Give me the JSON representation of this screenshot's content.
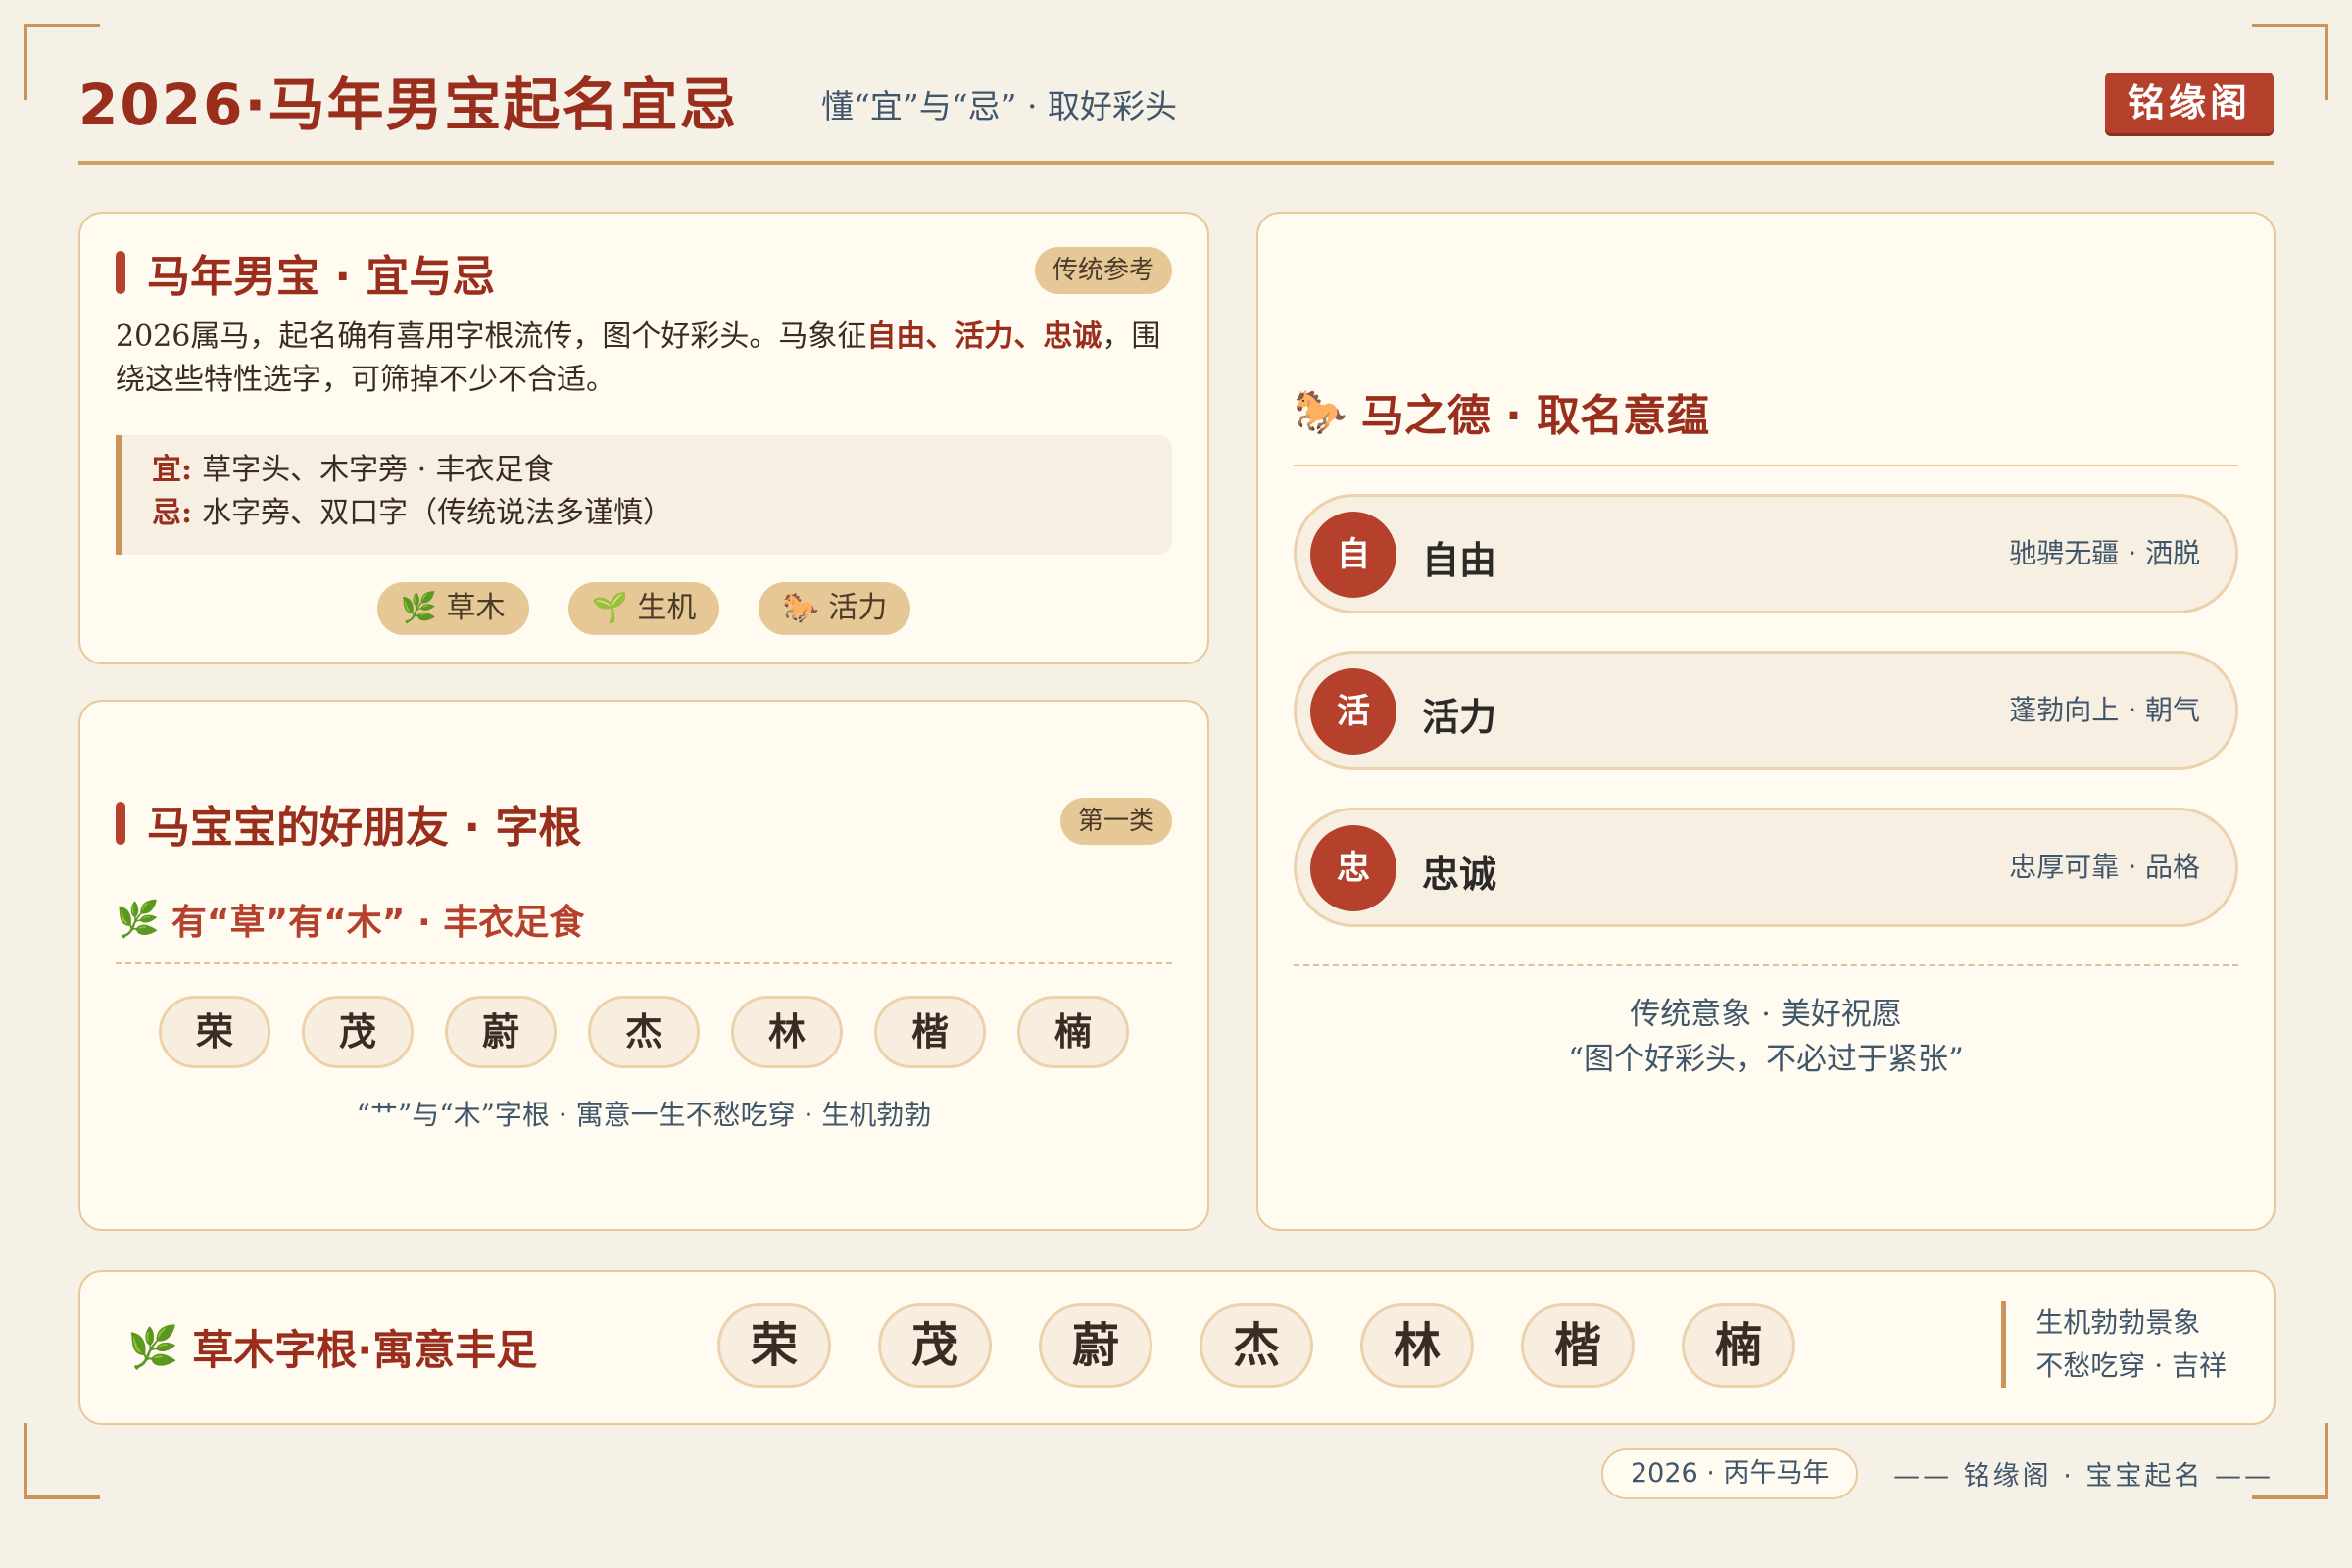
{
  "header": {
    "title": "2026·马年男宝起名宜忌",
    "subtitle": "懂“宜”与“忌” · 取好彩头",
    "brand": "铭缘阁"
  },
  "card_a": {
    "title": "马年男宝 · 宜与忌",
    "tag": "传统参考",
    "para_1": "2026属马，起名确有喜用字根流传，图个好彩头。马象征",
    "para_highlight": "自由、活力、忠诚",
    "para_2": "，围绕这些特性选字，可筛掉不少不合适。",
    "yi_label": "宜:",
    "yi_text": "草字头、木字旁 · 丰衣足食",
    "ji_label": "忌:",
    "ji_text": "水字旁、双口字（传统说法多谨慎）",
    "chips": [
      "🌿 草木",
      "🌱 生机",
      "🐎 活力"
    ]
  },
  "card_b": {
    "title": "马宝宝的好朋友 · 字根",
    "tag": "第一类",
    "subsection": "有“草”有“木” · 丰衣足食",
    "subsection_icon": "🌿",
    "roots": [
      "荣",
      "茂",
      "蔚",
      "杰",
      "林",
      "楷",
      "楠"
    ],
    "caption": "“艹”与“木”字根 · 寓意一生不愁吃穿 · 生机勃勃"
  },
  "card_c": {
    "title": "马之德 · 取名意蕴",
    "title_icon": "🐎",
    "virtues": [
      {
        "char": "自",
        "name": "自由",
        "desc": "驰骋无疆 · 洒脱"
      },
      {
        "char": "活",
        "name": "活力",
        "desc": "蓬勃向上 · 朝气"
      },
      {
        "char": "忠",
        "name": "忠诚",
        "desc": "忠厚可靠 · 品格"
      }
    ],
    "foot_1": "传统意象 · 美好祝愿",
    "foot_2": "“图个好彩头，不必过于紧张”"
  },
  "card_d": {
    "title": "草木字根·寓意丰足",
    "title_icon": "🌿",
    "roots": [
      "荣",
      "茂",
      "蔚",
      "杰",
      "林",
      "楷",
      "楠"
    ],
    "side_1": "生机勃勃景象",
    "side_2": "不愁吃穿 · 吉祥"
  },
  "footer": {
    "year": "2026 · 丙午马年",
    "text": "—— 铭缘阁 · 宝宝起名 ——"
  },
  "colors": {
    "background": "#f6f1e7",
    "accent_red": "#b5402c",
    "title_red": "#9a2e1c",
    "gold": "#c9955a",
    "tag_gold": "#e6c896",
    "slate": "#3f566b"
  }
}
